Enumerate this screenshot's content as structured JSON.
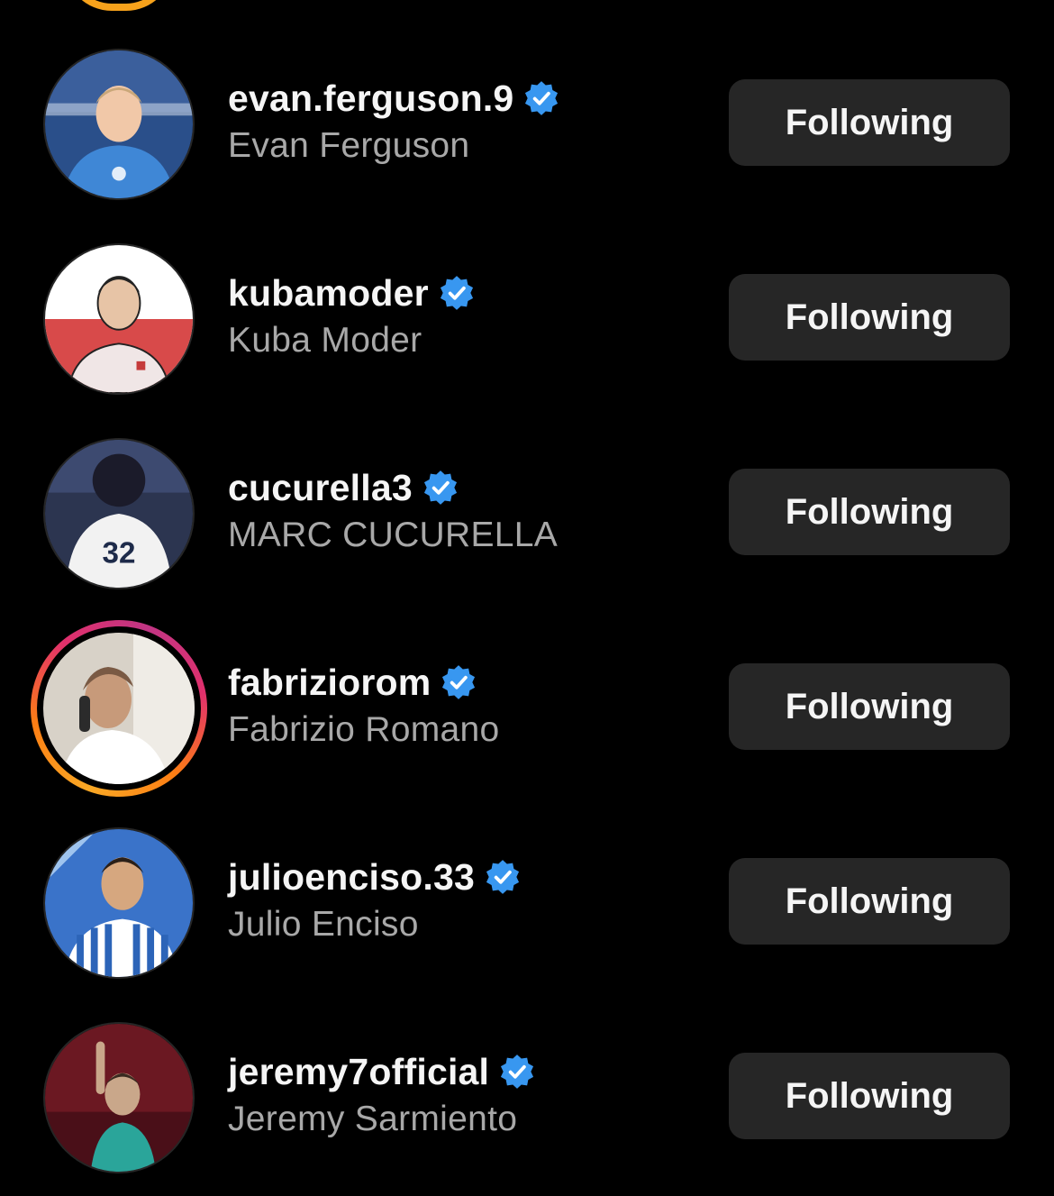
{
  "accounts": [
    {
      "username": "evan.ferguson.9",
      "full_name": "Evan Ferguson",
      "verified": true,
      "has_story_ring": false,
      "button_label": "Following",
      "avatar_palette": [
        "#2a4f8a",
        "#3f87d6",
        "#f1c8a8"
      ]
    },
    {
      "username": "kubamoder",
      "full_name": "Kuba Moder",
      "verified": true,
      "has_story_ring": false,
      "button_label": "Following",
      "avatar_palette": [
        "#ffffff",
        "#d84a4a",
        "#f0e6e6"
      ]
    },
    {
      "username": "cucurella3",
      "full_name": "MARC CUCURELLA",
      "verified": true,
      "has_story_ring": false,
      "button_label": "Following",
      "avatar_palette": [
        "#2c3550",
        "#f2f2f2",
        "#1b1b2a"
      ]
    },
    {
      "username": "fabriziorom",
      "full_name": "Fabrizio Romano",
      "verified": true,
      "has_story_ring": true,
      "button_label": "Following",
      "avatar_palette": [
        "#d8d2c8",
        "#7a5a44",
        "#ffffff"
      ]
    },
    {
      "username": "julioenciso.33",
      "full_name": "Julio Enciso",
      "verified": true,
      "has_story_ring": false,
      "button_label": "Following",
      "avatar_palette": [
        "#3a73c9",
        "#9fc4ee",
        "#ffffff"
      ]
    },
    {
      "username": "jeremy7official",
      "full_name": "Jeremy Sarmiento",
      "verified": true,
      "has_story_ring": false,
      "button_label": "Following",
      "avatar_palette": [
        "#6b1822",
        "#2aa59a",
        "#c9a78a"
      ]
    }
  ],
  "colors": {
    "background": "#000000",
    "button_bg": "#262626",
    "username": "#f5f5f5",
    "full_name": "#a8a8a8",
    "verified_badge": "#3897f0"
  }
}
